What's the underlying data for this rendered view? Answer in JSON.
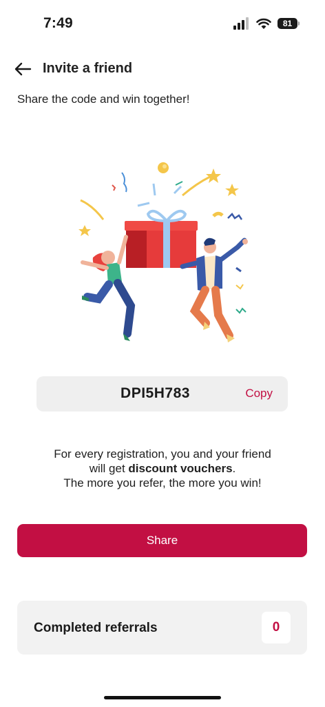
{
  "status_bar": {
    "time": "7:49",
    "battery": "81"
  },
  "header": {
    "title": "Invite a friend",
    "back_icon": "arrow-left-icon"
  },
  "subtitle": "Share the code and win together!",
  "illustration": {
    "icon": "gift-celebration-illustration"
  },
  "referral_code": {
    "code": "DPI5H783",
    "copy_label": "Copy"
  },
  "info": {
    "line1": "For every registration, you and your friend",
    "line2_prefix": "will get ",
    "line2_bold": "discount vouchers",
    "line2_suffix": ".",
    "line3": "The more you refer, the more you win!"
  },
  "share_label": "Share",
  "referrals": {
    "label": "Completed referrals",
    "count": "0"
  },
  "colors": {
    "accent": "#c20f43",
    "card_bg": "#efefef"
  }
}
